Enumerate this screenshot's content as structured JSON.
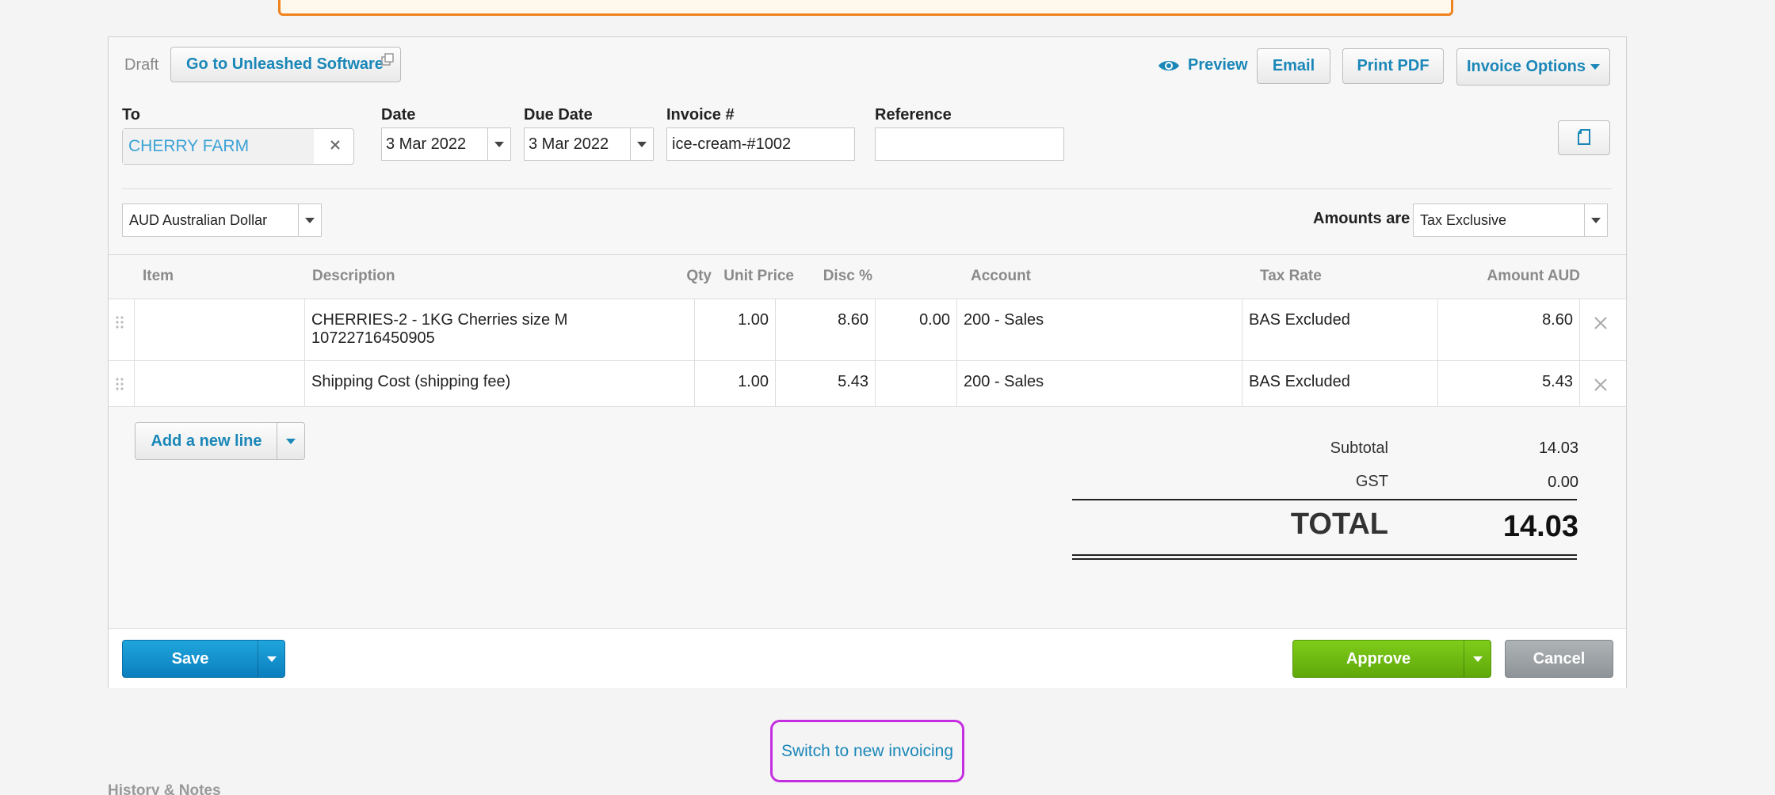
{
  "topbar": {
    "status": "Draft",
    "goto_label": "Go to Unleashed Software",
    "preview_label": "Preview",
    "email_label": "Email",
    "print_label": "Print PDF",
    "options_label": "Invoice Options"
  },
  "header": {
    "to_label": "To",
    "to_value": "CHERRY FARM",
    "date_label": "Date",
    "date_value": "3 Mar 2022",
    "due_label": "Due Date",
    "due_value": "3 Mar 2022",
    "invoice_label": "Invoice #",
    "invoice_value": "ice-cream-#1002",
    "reference_label": "Reference",
    "reference_value": "",
    "currency": "AUD Australian Dollar",
    "amounts_label": "Amounts are",
    "amounts_value": "Tax Exclusive"
  },
  "table": {
    "columns": [
      "Item",
      "Description",
      "Qty",
      "Unit Price",
      "Disc %",
      "Account",
      "Tax Rate",
      "Amount AUD"
    ],
    "rows": [
      {
        "item": "",
        "description_1": "CHERRIES-2 - 1KG Cherries size M",
        "description_2": "10722716450905",
        "qty": "1.00",
        "unit_price": "8.60",
        "disc": "0.00",
        "account": "200 - Sales",
        "tax_rate": "BAS Excluded",
        "amount": "8.60"
      },
      {
        "item": "",
        "description_1": "Shipping Cost (shipping fee)",
        "description_2": "",
        "qty": "1.00",
        "unit_price": "5.43",
        "disc": "",
        "account": "200 - Sales",
        "tax_rate": "BAS Excluded",
        "amount": "5.43"
      }
    ],
    "add_line_label": "Add a new line"
  },
  "totals": {
    "subtotal_label": "Subtotal",
    "subtotal_value": "14.03",
    "gst_label": "GST",
    "gst_value": "0.00",
    "total_label": "TOTAL",
    "total_value": "14.03"
  },
  "footer": {
    "save_label": "Save",
    "approve_label": "Approve",
    "cancel_label": "Cancel"
  },
  "switch_label": "Switch to new invoicing",
  "history_label": "History & Notes",
  "colors": {
    "accent": "#1a87b8",
    "approve": "#6cb812",
    "save": "#1496d1",
    "highlight": "#c42ee0",
    "alert": "#f0821e"
  }
}
